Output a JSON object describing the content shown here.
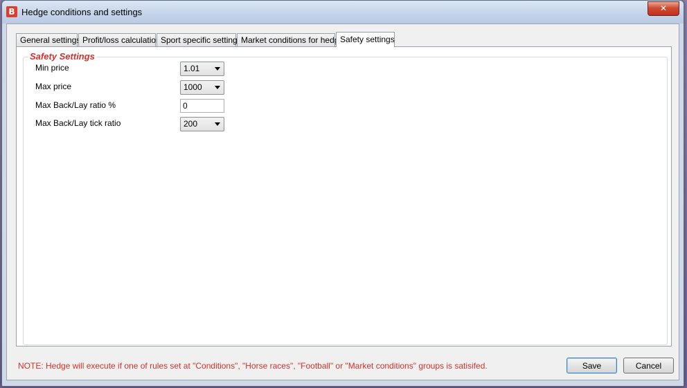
{
  "window": {
    "title": "Hedge conditions and settings",
    "icon_letter": "B",
    "close_glyph": "✕"
  },
  "tabs": [
    {
      "label": "General settings",
      "active": false
    },
    {
      "label": "Profit/loss calculation",
      "active": false
    },
    {
      "label": "Sport specific settings",
      "active": false
    },
    {
      "label": "Market conditions for hedge",
      "active": false
    },
    {
      "label": "Safety settings",
      "active": true
    }
  ],
  "safety": {
    "group_title": "Safety Settings",
    "min_price": {
      "label": "Min price",
      "value": "1.01"
    },
    "max_price": {
      "label": "Max price",
      "value": "1000"
    },
    "max_back_lay_ratio": {
      "label": "Max Back/Lay ratio %",
      "value": "0"
    },
    "max_back_lay_tick_ratio": {
      "label": "Max Back/Lay tick ratio",
      "value": "200"
    }
  },
  "footer": {
    "note": "NOTE: Hedge will execute if one of rules set at \"Conditions\", \"Horse races\", \"Football\" or \"Market conditions\" groups is satisifed.",
    "save_label": "Save",
    "cancel_label": "Cancel"
  },
  "colors": {
    "accent_red": "#d3312b",
    "titlebar": "#c4d3e8",
    "close_button": "#c0311c"
  }
}
